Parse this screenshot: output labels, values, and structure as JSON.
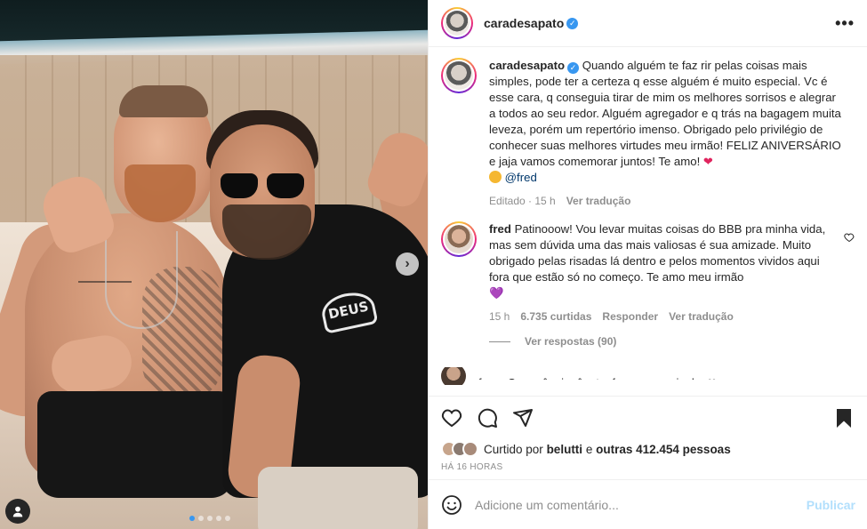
{
  "post": {
    "carousel_dots": 5,
    "active_dot": 0
  },
  "header": {
    "username": "caradesapato",
    "more_label": "•••"
  },
  "caption": {
    "username": "caradesapato",
    "text": "Quando alguém te faz rir pelas coisas mais simples, pode ter a certeza q esse alguém é muito especial. Vc é esse cara, q conseguia tirar de mim os melhores sorrisos e alegrar a todos ao seu redor. Alguém agregador e q trás na bagagem muita leveza, porém um repertório imenso. Obrigado pelo privilégio de conhecer suas melhores virtudes meu irmão! FELIZ ANIVERSÁRIO e jaja vamos comemorar juntos! Te amo!",
    "heart": "❤",
    "mention": "@fred",
    "edited": "Editado · 15 h",
    "translate": "Ver tradução"
  },
  "comments": [
    {
      "username": "fred",
      "text": "Patinooow! Vou levar muitas coisas do BBB pra minha vida, mas sem dúvida uma das mais valiosas é sua amizade. Muito obrigado pelas risadas lá dentro e pelos momentos vividos aqui fora que estão só no começo. Te amo meu irmão",
      "heart": "💜",
      "time": "15 h",
      "likes": "6.735 curtidas",
      "reply": "Responder",
      "translate": "Ver tradução",
      "view_replies": "Ver respostas (90)"
    }
  ],
  "partial_comment": "fr...... O m... ê... i... ê... t... f... ... ... ... ...i... l... ❤",
  "likes": {
    "prefix": "Curtido por",
    "user": "belutti",
    "and": "e",
    "others": "outras 412.454 pessoas"
  },
  "timestamp": "HÁ 16 HORAS",
  "add_comment": {
    "placeholder": "Adicione um comentário...",
    "publish": "Publicar"
  },
  "colors": {
    "verified": "#3897f0",
    "publish": "#b2dffc",
    "mention": "#00376b"
  },
  "icons": [
    "user-tag-icon",
    "chevron-right-icon",
    "more-icon",
    "verified-icon",
    "heart-icon",
    "comment-icon",
    "share-icon",
    "bookmark-icon",
    "emoji-icon"
  ]
}
